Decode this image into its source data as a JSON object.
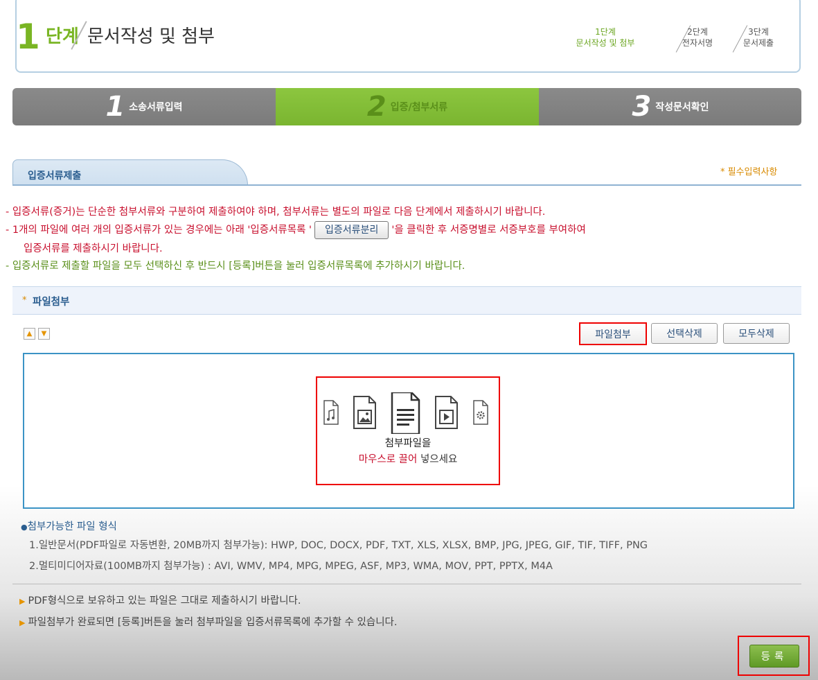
{
  "header": {
    "step_number": "1",
    "step_word": "단계",
    "step_title": "문서작성 및 첨부",
    "mini_steps": [
      {
        "line1": "1단계",
        "line2": "문서작성 및 첨부"
      },
      {
        "line1": "2단계",
        "line2": "전자서명"
      },
      {
        "line1": "3단계",
        "line2": "문서제출"
      }
    ]
  },
  "progress": {
    "steps": [
      {
        "num": "1",
        "label": "소송서류입력",
        "active": false
      },
      {
        "num": "2",
        "label": "입증/첨부서류",
        "active": true
      },
      {
        "num": "3",
        "label": "작성문서확인",
        "active": false
      }
    ]
  },
  "section": {
    "tab_label": "입증서류제출",
    "required_note": "* 필수입력사항"
  },
  "notes": {
    "n1": "- 입증서류(증거)는 단순한 첨부서류와 구분하여 제출하여야 하며, 첨부서류는 별도의 파일로 다음 단계에서 제출하시기 바랍니다.",
    "n2_pre": "- 1개의 파일에 여러 개의 입증서류가 있는 경우에는 아래 '입증서류목록 '",
    "n2_button": "입증서류분리",
    "n2_post": "'을 클릭한 후 서증명별로 서증부호를 부여하여",
    "n3": "입증서류를 제출하시기 바랍니다.",
    "n4": "- 입증서류로 제출할 파일을 모두 선택하신 후 반드시 [등록]버튼을 눌러 입증서류목록에 추가하시기 바랍니다."
  },
  "attach": {
    "star": "*",
    "label": "파일첨부",
    "attach_button": "파일첨부",
    "delete_selected_button": "선택삭제",
    "delete_all_button": "모두삭제",
    "drop_line1": "첨부파일을",
    "drop_line2_red": "마우스로 끌어",
    "drop_line2_rest": " 넣으세요"
  },
  "formats": {
    "heading": "첨부가능한 파일 형식",
    "line1": "1.일반문서(PDF파일로 자동변환, 20MB까지 첨부가능): HWP, DOC, DOCX, PDF, TXT, XLS, XLSX, BMP, JPG, JPEG, GIF, TIF, TIFF, PNG",
    "line2": "2.멀티미디어자료(100MB까지 첨부가능) : AVI, WMV, MP4, MPG, MPEG, ASF, MP3, WMA, MOV, PPT, PPTX, M4A"
  },
  "bullets": {
    "b1": "PDF형식으로 보유하고 있는 파일은 그대로 제출하시기 바랍니다.",
    "b2": "파일첨부가 완료되면 [등록]버튼을 눌러 첨부파일을 입증서류목록에 추가할 수 있습니다."
  },
  "register_button": "등록",
  "colors": {
    "green": "#7ab530",
    "gray": "#7b7b7b",
    "blue": "#2a5d8f",
    "red": "#c8102e",
    "highlight": "#e00000"
  }
}
